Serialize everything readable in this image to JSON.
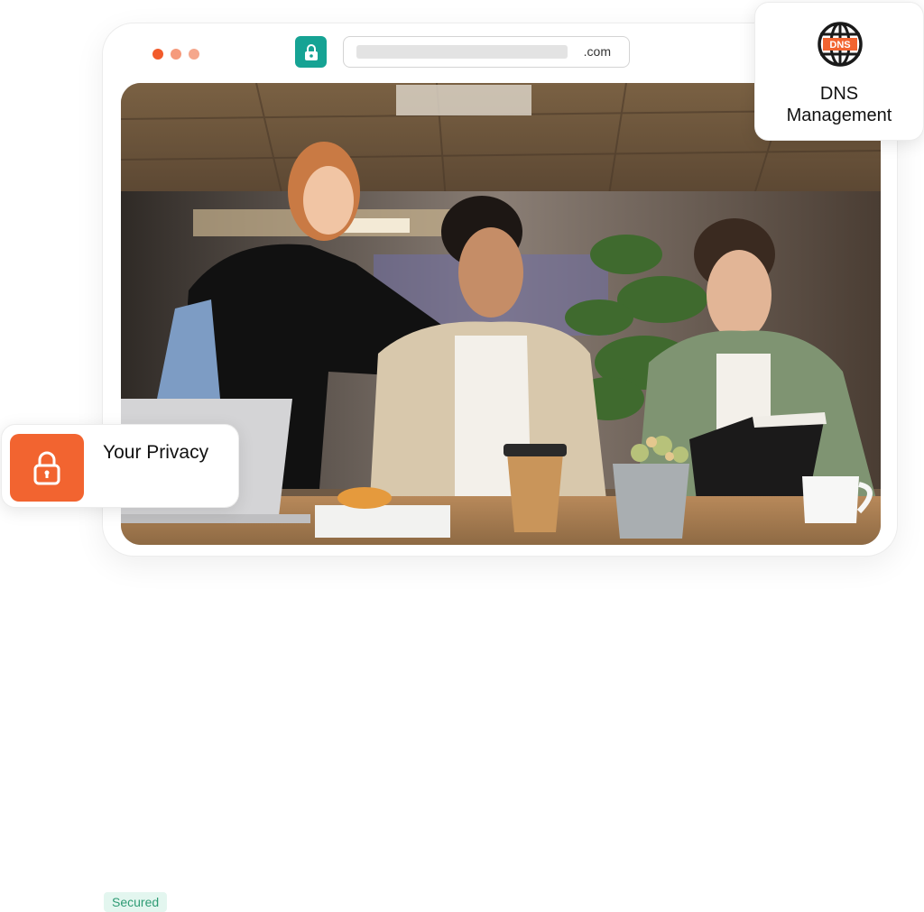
{
  "browser": {
    "window_dots": [
      "#f25b2b",
      "#f59a7c",
      "#f5a78c"
    ],
    "url_suffix": ".com",
    "lock_color": "#16a394"
  },
  "hero_image": {
    "description_icon": "photo-image"
  },
  "dns_card": {
    "icon": "dns-globe-icon",
    "title_line1": "DNS",
    "title_line2": "Management",
    "globe_label": "DNS"
  },
  "privacy_card": {
    "icon": "lock-icon",
    "accent": "#f26430",
    "title": "Your Privacy",
    "badge": "Secured"
  }
}
